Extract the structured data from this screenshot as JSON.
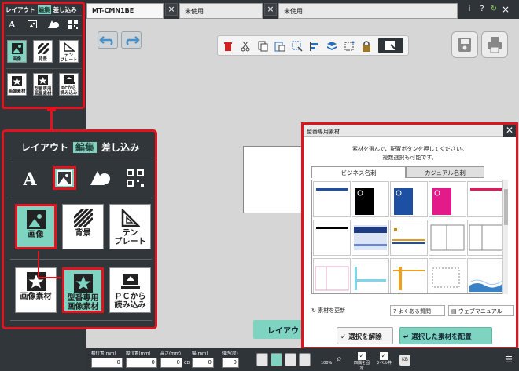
{
  "tabs": [
    {
      "label": "MT-CMN1BE",
      "active": true
    },
    {
      "label": "未使用",
      "active": false
    },
    {
      "label": "未使用",
      "active": false
    }
  ],
  "top_icons": [
    "info-icon",
    "help-icon",
    "undo-arrow-icon",
    "close-icon"
  ],
  "top_labels": {
    "info": "i",
    "help": "?"
  },
  "small_panel": {
    "tabs": [
      {
        "label": "レイアウト",
        "selected": false
      },
      {
        "label": "編集",
        "selected": true
      },
      {
        "label": "差し込み",
        "selected": false
      }
    ],
    "text_icon": "A",
    "tiles_row1": [
      {
        "label": "画像",
        "icon": "image-icon",
        "selected": true
      },
      {
        "label": "背景",
        "icon": "background-icon",
        "selected": false
      },
      {
        "label": "テン\nプレート",
        "icon": "template-icon",
        "selected": false
      }
    ],
    "tiles_row2": [
      {
        "label": "画像素材",
        "icon": "star-image-icon",
        "selected": false
      },
      {
        "label": "型番専用\n画像素材",
        "icon": "star-model-image-icon",
        "selected": false
      },
      {
        "label": "PCから\n読み込み",
        "icon": "pc-upload-icon",
        "selected": false
      }
    ]
  },
  "zoom_panel": {
    "tabs": [
      {
        "label": "レイアウト",
        "selected": false
      },
      {
        "label": "編集",
        "selected": true
      },
      {
        "label": "差し込み",
        "selected": false
      }
    ],
    "text_icon": "A",
    "tiles_row1": [
      {
        "label": "画像",
        "selected": true
      },
      {
        "label": "背景",
        "selected": false
      },
      {
        "label": "テン\nプレート",
        "selected": false
      }
    ],
    "tiles_row2": [
      {
        "label": "画像素材",
        "selected": false
      },
      {
        "label": "型番専用\n画像素材",
        "selected": true
      },
      {
        "label": "ＰＣから\n読み込み",
        "selected": false
      }
    ]
  },
  "dialog": {
    "title": "型番専用素材",
    "message_line1": "素材を選んで、配置ボタンを押してください。",
    "message_line2": "複数選択も可能です。",
    "tabs": [
      {
        "label": "ビジネス名刺",
        "selected": true
      },
      {
        "label": "カジュアル名刺",
        "selected": false
      }
    ],
    "links": {
      "refresh": "素材を更新",
      "faq": "よくある質問",
      "manual": "ウェブマニュアル"
    },
    "buttons": {
      "clear": "選択を解除",
      "place": "選択した素材を配置"
    },
    "close_label": "✕"
  },
  "layout_hint": "レイアウ",
  "statusbar": {
    "fields": [
      {
        "label": "横位置(mm)",
        "value": "0"
      },
      {
        "label": "縦位置(mm)",
        "value": "0"
      },
      {
        "label": "高さ(mm)",
        "value": "0"
      },
      {
        "label": "幅(mm)",
        "value": "0"
      },
      {
        "label": "傾き(度)",
        "value": "0"
      }
    ],
    "link_symbol": "CD",
    "zoom": "100%",
    "check_labels": [
      "四隅を固定",
      "ラベル枠"
    ],
    "kb_label": "KB"
  },
  "colors": {
    "accent": "#7fd4c1",
    "highlight": "#e0141e",
    "dark": "#2e3438"
  }
}
